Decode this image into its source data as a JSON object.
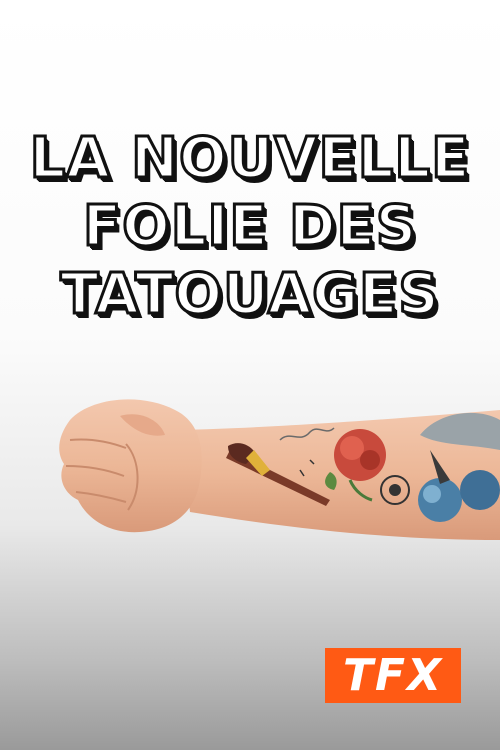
{
  "title": {
    "line1": "LA NOUVELLE",
    "line2": "FOLIE DES",
    "line3": "TATOUAGES"
  },
  "logo": {
    "text": "TFX",
    "color": "#ff5a14"
  },
  "image": {
    "subject": "tattooed-arm-with-fist"
  }
}
